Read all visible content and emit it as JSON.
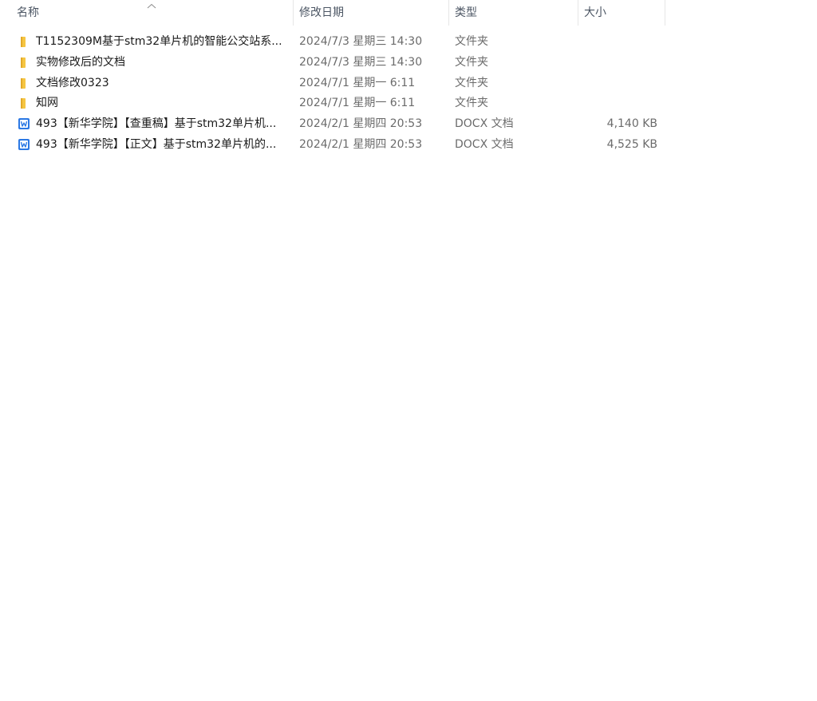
{
  "header": {
    "name": "名称",
    "modified": "修改日期",
    "type": "类型",
    "size": "大小",
    "sort_indicator": "chevron-up-icon"
  },
  "colors": {
    "folder": "#f5c542",
    "word": "#2b78e4"
  },
  "files": [
    {
      "icon": "folder-icon",
      "name": "T1152309M基于stm32单片机的智能公交站系...",
      "modified": "2024/7/3 星期三 14:30",
      "type": "文件夹",
      "size": ""
    },
    {
      "icon": "folder-icon",
      "name": "实物修改后的文档",
      "modified": "2024/7/3 星期三 14:30",
      "type": "文件夹",
      "size": ""
    },
    {
      "icon": "folder-icon",
      "name": "文档修改0323",
      "modified": "2024/7/1 星期一 6:11",
      "type": "文件夹",
      "size": ""
    },
    {
      "icon": "folder-icon",
      "name": "知网",
      "modified": "2024/7/1 星期一 6:11",
      "type": "文件夹",
      "size": ""
    },
    {
      "icon": "word-doc-icon",
      "name": "493【新华学院】【查重稿】基于stm32单片机...",
      "modified": "2024/2/1 星期四 20:53",
      "type": "DOCX 文档",
      "size": "4,140 KB"
    },
    {
      "icon": "word-doc-icon",
      "name": "493【新华学院】【正文】基于stm32单片机的...",
      "modified": "2024/2/1 星期四 20:53",
      "type": "DOCX 文档",
      "size": "4,525 KB"
    }
  ]
}
